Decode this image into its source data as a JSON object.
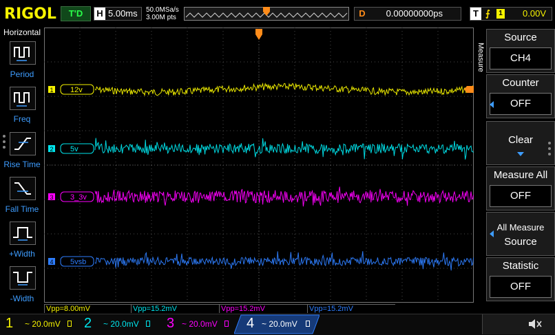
{
  "brand": "RIGOL",
  "run_state": "T'D",
  "horizontal": {
    "label": "H",
    "timebase": "5.00ms"
  },
  "sampling": {
    "rate": "50.0MSa/s",
    "points": "3.00M pts"
  },
  "delay": {
    "label": "D",
    "value": "0.00000000ps"
  },
  "trigger": {
    "label": "T",
    "edge_icon": "rising-edge-icon",
    "source": "1",
    "level": "0.00V"
  },
  "left_menu": {
    "title": "Horizontal",
    "items": [
      {
        "label": "Period",
        "icon": "period-icon"
      },
      {
        "label": "Freq",
        "icon": "freq-icon"
      },
      {
        "label": "Rise Time",
        "icon": "rise-time-icon"
      },
      {
        "label": "Fall Time",
        "icon": "fall-time-icon"
      },
      {
        "label": "+Width",
        "icon": "pos-width-icon"
      },
      {
        "label": "-Width",
        "icon": "neg-width-icon"
      }
    ]
  },
  "channels": [
    {
      "num": "1",
      "label": "12v",
      "color": "#f6f300",
      "scale": "20.0mV",
      "meas": "Vpp=8.00mV",
      "level_frac": 0.225
    },
    {
      "num": "2",
      "label": "5v",
      "color": "#00e6ee",
      "scale": "20.0mV",
      "meas": "Vpp=15.2mV",
      "level_frac": 0.44
    },
    {
      "num": "3",
      "label": "3_3v",
      "color": "#ff00ff",
      "scale": "20.0mV",
      "meas": "Vpp=15.2mV",
      "level_frac": 0.615
    },
    {
      "num": "4",
      "label": "5vsb",
      "color": "#2e7eff",
      "scale": "20.0mV",
      "meas": "Vpp=15.2mV",
      "level_frac": 0.85
    }
  ],
  "right_menu": {
    "side_label": "Measure",
    "items": [
      {
        "title": "Source",
        "value": "CH4"
      },
      {
        "title": "Counter",
        "value": "OFF"
      },
      {
        "title": "Clear",
        "value": ""
      },
      {
        "title": "Measure All",
        "value": "OFF"
      },
      {
        "title": "All Measure",
        "value": "Source"
      },
      {
        "title": "Statistic",
        "value": "OFF"
      }
    ]
  },
  "colors": {
    "brand": "#f6f300",
    "grid": "#3a3a3a",
    "accent": "#3e9dff",
    "trigger": "#ff8c1a"
  }
}
